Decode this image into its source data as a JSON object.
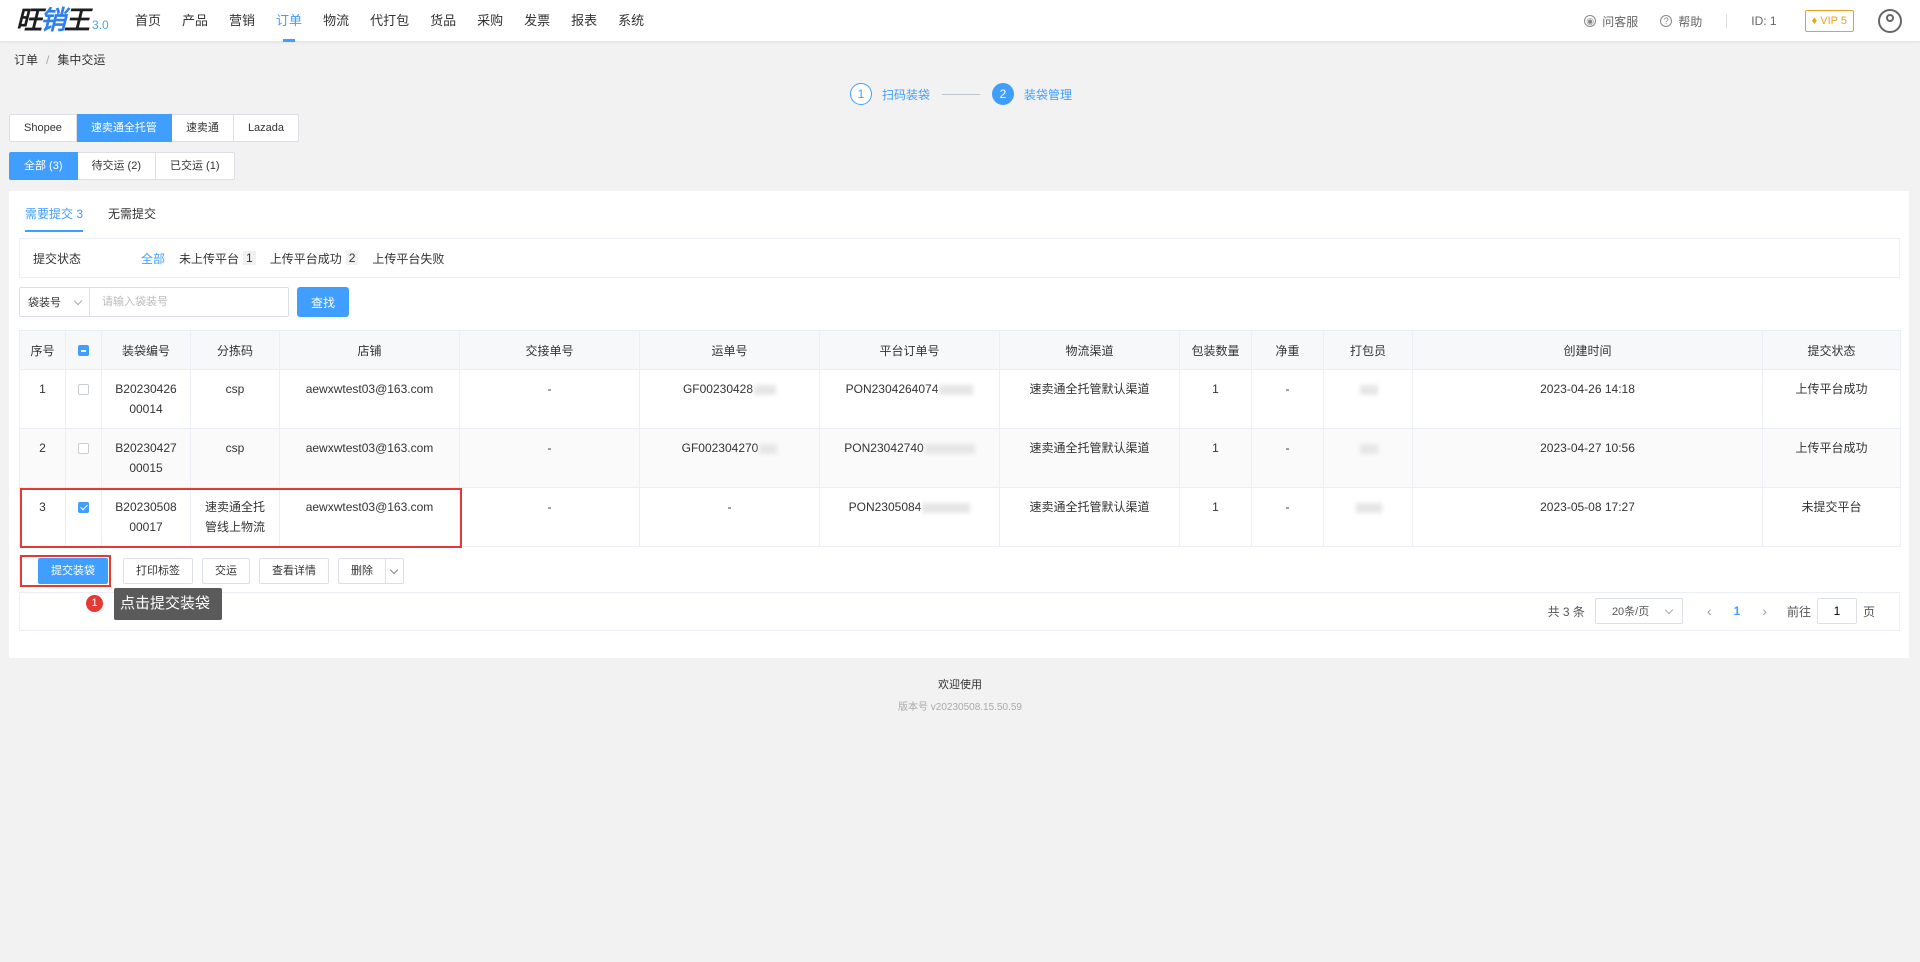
{
  "app": {
    "logo_text_a": "旺",
    "logo_text_b": "销",
    "logo_text_c": "王",
    "version": "3.0"
  },
  "nav": {
    "items": [
      {
        "label": "首页",
        "active": false
      },
      {
        "label": "产品",
        "active": false
      },
      {
        "label": "营销",
        "active": false
      },
      {
        "label": "订单",
        "active": true
      },
      {
        "label": "物流",
        "active": false
      },
      {
        "label": "代打包",
        "active": false
      },
      {
        "label": "货品",
        "active": false
      },
      {
        "label": "采购",
        "active": false
      },
      {
        "label": "发票",
        "active": false
      },
      {
        "label": "报表",
        "active": false
      },
      {
        "label": "系统",
        "active": false
      }
    ]
  },
  "topright": {
    "service": "问客服",
    "help": "帮助",
    "id_label": "ID: 1",
    "vip": "VIP 5"
  },
  "breadcrumb": {
    "root": "订单",
    "separator": "/",
    "current": "集中交运"
  },
  "steps": [
    {
      "num": "1",
      "label": "扫码装袋"
    },
    {
      "num": "2",
      "label": "装袋管理"
    }
  ],
  "platform_tabs": [
    "Shopee",
    "速卖通全托管",
    "速卖通",
    "Lazada"
  ],
  "status_tabs": [
    "全部 (3)",
    "待交运 (2)",
    "已交运 (1)"
  ],
  "subtabs": [
    "需要提交 3",
    "无需提交"
  ],
  "filter": {
    "label": "提交状态",
    "options": [
      {
        "label": "全部",
        "count": ""
      },
      {
        "label": "未上传平台",
        "count": "1"
      },
      {
        "label": "上传平台成功",
        "count": "2"
      },
      {
        "label": "上传平台失败",
        "count": ""
      }
    ]
  },
  "search": {
    "select_value": "袋装号",
    "placeholder": "请输入袋装号",
    "button": "查找"
  },
  "table": {
    "headers": [
      "序号",
      "",
      "装袋编号",
      "分拣码",
      "店铺",
      "交接单号",
      "运单号",
      "平台订单号",
      "物流渠道",
      "包装数量",
      "净重",
      "打包员",
      "创建时间",
      "提交状态"
    ],
    "rows": [
      {
        "no": "1",
        "checked": false,
        "bag_no": "B20230426\n00014",
        "sort_code": "csp",
        "shop": "aewxwtest03@163.com",
        "handover": "-",
        "waybill": "GF00230428",
        "platform_order": "PON2304264074",
        "channel": "速卖通全托管默认渠道",
        "qty": "1",
        "weight": "-",
        "packer": "",
        "created": "2023-04-26 14:18",
        "status": "上传平台成功",
        "status_type": "ok"
      },
      {
        "no": "2",
        "checked": false,
        "bag_no": "B20230427\n00015",
        "sort_code": "csp",
        "shop": "aewxwtest03@163.com",
        "handover": "-",
        "waybill": "GF002304270",
        "platform_order": "PON23042740",
        "channel": "速卖通全托管默认渠道",
        "qty": "1",
        "weight": "-",
        "packer": "",
        "created": "2023-04-27 10:56",
        "status": "上传平台成功",
        "status_type": "ok"
      },
      {
        "no": "3",
        "checked": true,
        "bag_no": "B20230508\n00017",
        "sort_code": "速卖通全托\n管线上物流",
        "shop": "aewxwtest03@163.com",
        "handover": "-",
        "waybill": "-",
        "platform_order": "PON2305084",
        "channel": "速卖通全托管默认渠道",
        "qty": "1",
        "weight": "-",
        "packer": "",
        "created": "2023-05-08 17:27",
        "status": "未提交平台",
        "status_type": "pending"
      }
    ]
  },
  "actions": {
    "submit": "提交装袋",
    "print": "打印标签",
    "ship": "交运",
    "detail": "查看详情",
    "delete": "删除"
  },
  "tooltip": {
    "num": "1",
    "text": "点击提交装袋"
  },
  "pager": {
    "total": "共 3 条",
    "page_size": "20条/页",
    "current": "1",
    "goto_label": "前往",
    "goto_value": "1",
    "page_suffix": "页"
  },
  "footer": {
    "welcome": "欢迎使用",
    "version": "版本号 v20230508.15.50.59"
  },
  "colors": {
    "accent": "#409eff",
    "warning": "#f0a020",
    "highlight": "#e53935"
  }
}
